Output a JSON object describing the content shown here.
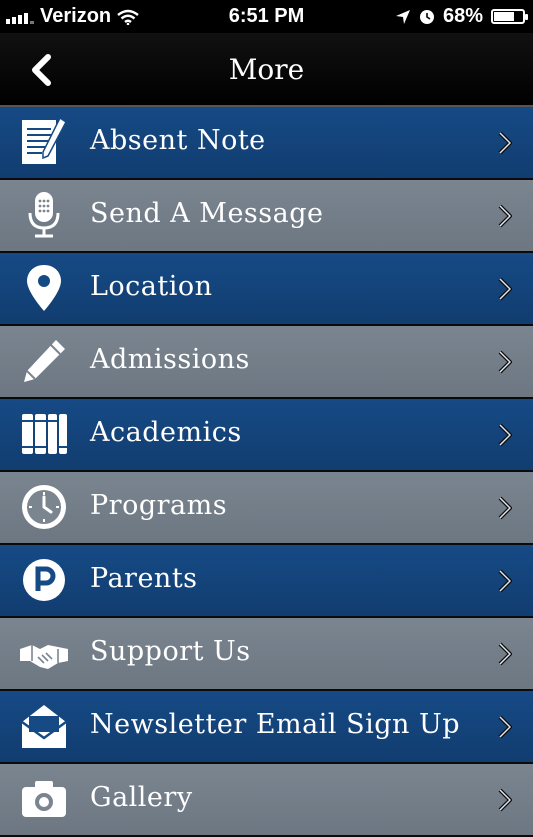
{
  "status_bar": {
    "carrier": "Verizon",
    "time": "6:51 PM",
    "battery": "68%",
    "battery_level": 0.68
  },
  "nav": {
    "title": "More",
    "back_icon": "chevron-left-icon"
  },
  "colors": {
    "row_blue": "#164a85",
    "row_gray": "#7b8590",
    "navbar": "#000000"
  },
  "menu": {
    "items": [
      {
        "label": "Absent Note",
        "icon": "note-icon",
        "style": "blue"
      },
      {
        "label": "Send A Message",
        "icon": "microphone-icon",
        "style": "gray"
      },
      {
        "label": "Location",
        "icon": "location-pin-icon",
        "style": "blue"
      },
      {
        "label": "Admissions",
        "icon": "pencil-icon",
        "style": "gray"
      },
      {
        "label": "Academics",
        "icon": "books-icon",
        "style": "blue"
      },
      {
        "label": "Programs",
        "icon": "clock-icon",
        "style": "gray"
      },
      {
        "label": "Parents",
        "icon": "parking-icon",
        "style": "blue"
      },
      {
        "label": "Support Us",
        "icon": "handshake-icon",
        "style": "gray"
      },
      {
        "label": "Newsletter Email Sign Up",
        "icon": "envelope-icon",
        "style": "blue"
      },
      {
        "label": "Gallery",
        "icon": "camera-icon",
        "style": "gray"
      }
    ]
  }
}
